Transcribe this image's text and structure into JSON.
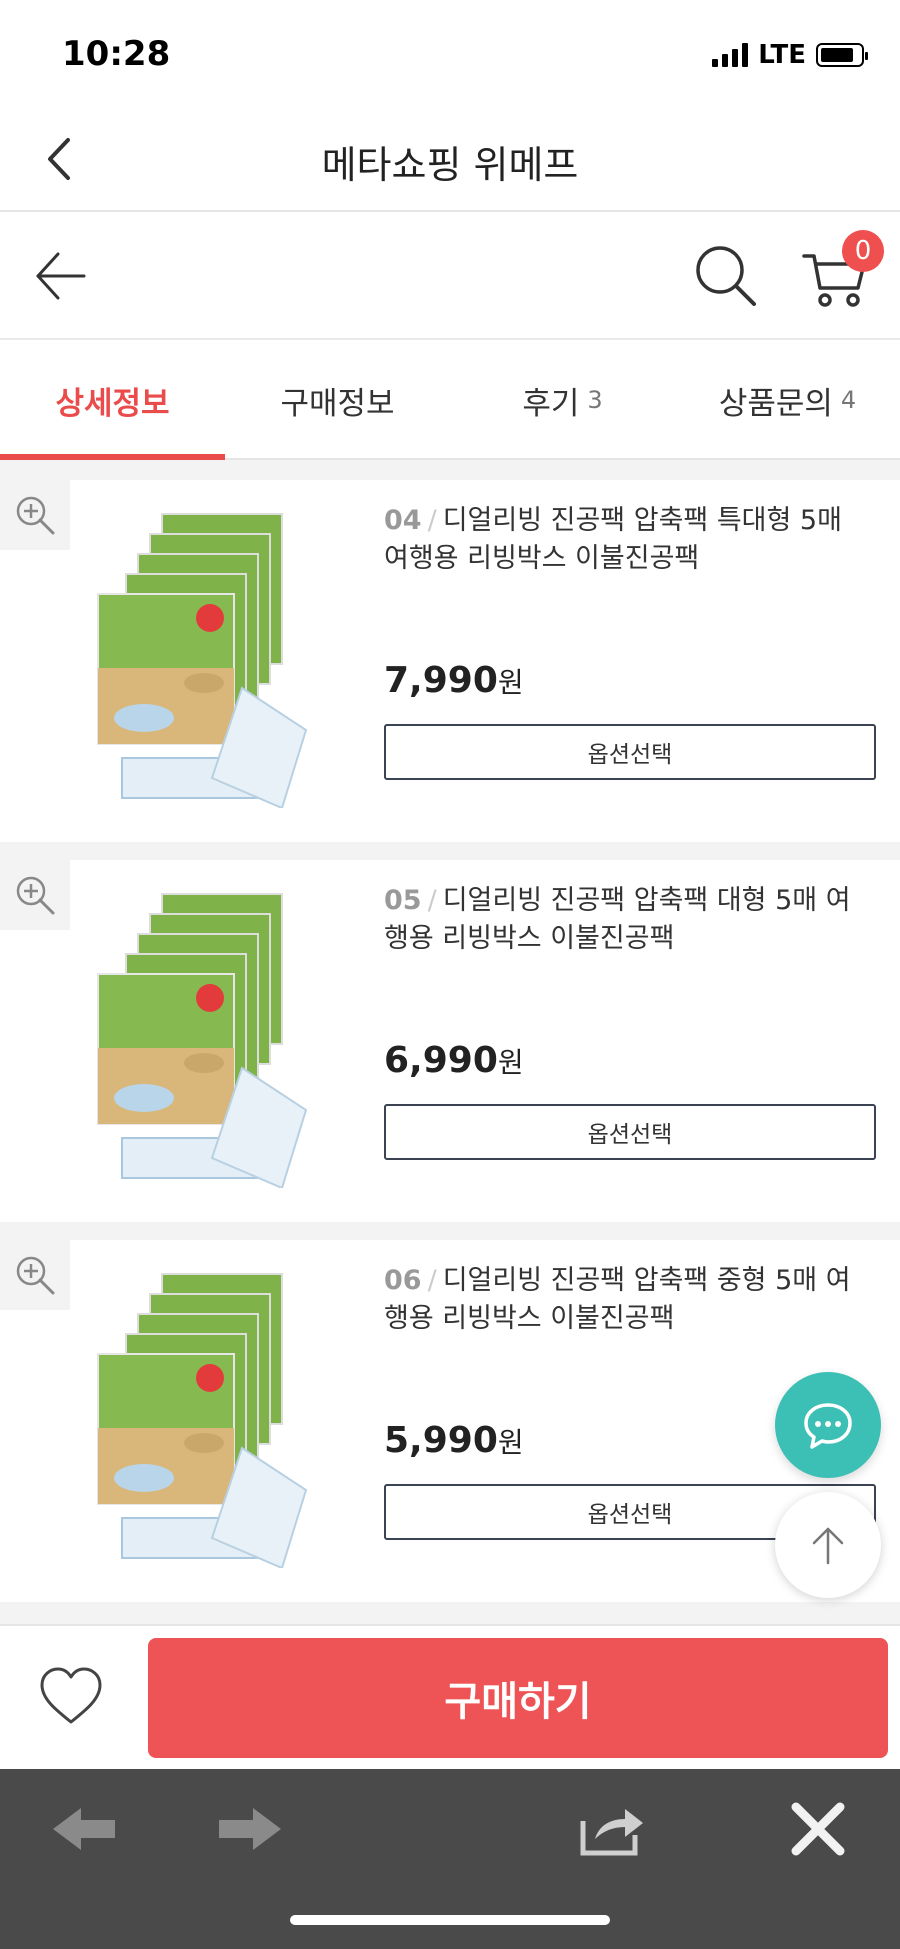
{
  "status": {
    "time": "10:28",
    "network": "LTE",
    "battery_level": 0.85
  },
  "title_bar": {
    "title": "메타쇼핑 위메프"
  },
  "header": {
    "cart_count": "0"
  },
  "tabs": [
    {
      "label": "상세정보",
      "count": ""
    },
    {
      "label": "구매정보",
      "count": ""
    },
    {
      "label": "후기",
      "count": "3"
    },
    {
      "label": "상품문의",
      "count": "4"
    }
  ],
  "products": [
    {
      "index": "04",
      "title": "디얼리빙 진공팩 압축팩 특대형 5매 여행용 리빙박스 이불진공팩",
      "price": "7,990",
      "currency": "원",
      "option_label": "옵션선택"
    },
    {
      "index": "05",
      "title": "디얼리빙 진공팩 압축팩 대형 5매 여행용 리빙박스 이불진공팩",
      "price": "6,990",
      "currency": "원",
      "option_label": "옵션선택"
    },
    {
      "index": "06",
      "title": "디얼리빙 진공팩 압축팩 중형 5매 여행용 리빙박스 이불진공팩",
      "price": "5,990",
      "currency": "원",
      "option_label": "옵션선택"
    }
  ],
  "bottom": {
    "buy_label": "구매하기"
  },
  "colors": {
    "accent": "#ea4b4b",
    "chat": "#3cbfb4",
    "browser_bar": "#4a4a4a"
  },
  "icons": [
    "back-chevron-icon",
    "back-arrow-icon",
    "search-icon",
    "cart-icon",
    "zoom-in-icon",
    "chat-icon",
    "arrow-up-icon",
    "heart-icon",
    "browser-back-icon",
    "browser-forward-icon",
    "share-icon",
    "close-icon"
  ]
}
